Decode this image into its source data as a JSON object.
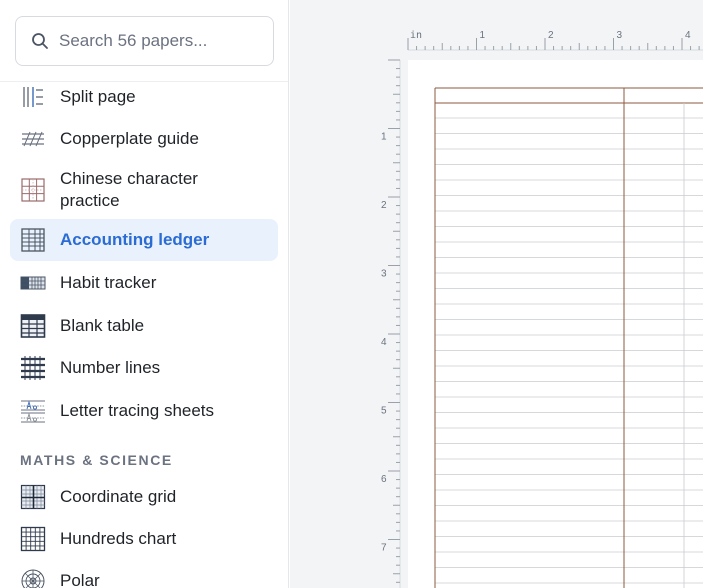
{
  "search": {
    "placeholder": "Search 56 papers..."
  },
  "sidebar": {
    "items_top": [
      {
        "label": "Split page",
        "icon": "split-page-icon"
      },
      {
        "label": "Copperplate guide",
        "icon": "copperplate-icon"
      },
      {
        "label": "Chinese character\npractice",
        "icon": "chinese-grid-icon"
      },
      {
        "label": "Accounting ledger",
        "icon": "ledger-icon",
        "active": true
      },
      {
        "label": "Habit tracker",
        "icon": "habit-tracker-icon"
      },
      {
        "label": "Blank table",
        "icon": "table-icon"
      },
      {
        "label": "Number lines",
        "icon": "number-lines-icon"
      },
      {
        "label": "Letter tracing sheets",
        "icon": "letter-tracing-icon"
      }
    ],
    "section_label": "MATHS & SCIENCE",
    "items_bottom": [
      {
        "label": "Coordinate grid",
        "icon": "coordinate-grid-icon"
      },
      {
        "label": "Hundreds chart",
        "icon": "hundreds-chart-icon"
      },
      {
        "label": "Polar",
        "icon": "polar-icon"
      }
    ]
  },
  "ruler": {
    "unit": "in",
    "top_numbers": [
      "1",
      "2",
      "3",
      "4"
    ],
    "left_numbers": [
      "1",
      "2",
      "3",
      "4",
      "5",
      "6",
      "7"
    ]
  },
  "colors": {
    "accent": "#2b6cd4",
    "ledger_line": "#8b5a3c",
    "rule_line": "#c9ccd0"
  }
}
